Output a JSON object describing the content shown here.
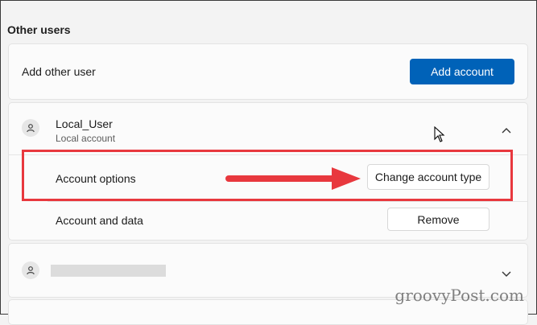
{
  "section_title": "Other users",
  "add_user": {
    "label": "Add other user",
    "button": "Add account"
  },
  "user_card": {
    "name": "Local_User",
    "subtitle": "Local account",
    "account_options_label": "Account options",
    "change_type_button": "Change account type",
    "account_data_label": "Account and data",
    "remove_button": "Remove"
  },
  "watermark": "groovyPost.com",
  "colors": {
    "accent": "#0062b8",
    "highlight": "#e8383e"
  },
  "icons": [
    "person-icon",
    "chevron-up-icon",
    "chevron-down-icon",
    "mouse-cursor-icon",
    "red-arrow"
  ]
}
